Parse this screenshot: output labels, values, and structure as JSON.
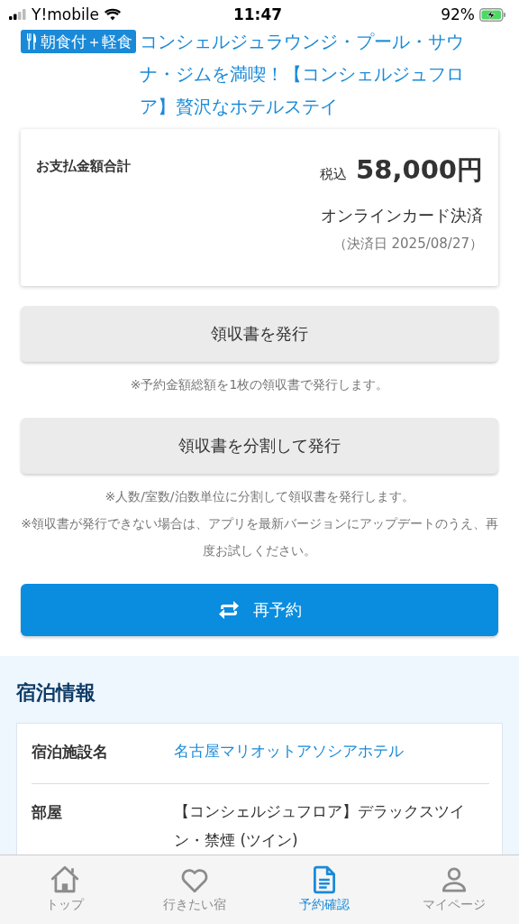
{
  "status_bar": {
    "carrier": "Y!mobile",
    "time": "11:47",
    "battery": "92%"
  },
  "plan": {
    "badge": "朝食付＋軽食",
    "title": "コンシェルジュラウンジ・プール・サウナ・ジムを満喫！【コンシェルジュフロア】贅沢なホテルステイ"
  },
  "payment": {
    "label": "お支払金額合計",
    "tax_label": "税込",
    "amount": "58,000円",
    "method": "オンラインカード決済",
    "date": "（決済日 2025/08/27）"
  },
  "actions": [
    {
      "kind": "plain",
      "label": "領収書を発行",
      "notes": [
        "※予約金額総額を1枚の領収書で発行します。"
      ]
    },
    {
      "kind": "plain",
      "label": "領収書を分割して発行",
      "notes": [
        "※人数/室数/泊数単位に分割して領収書を発行します。",
        "※領収書が発行できない場合は、アプリを最新バージョンにアップデートのうえ、再度お試しください。"
      ]
    },
    {
      "kind": "primary",
      "label": "再予約"
    }
  ],
  "stay_info": {
    "heading": "宿泊情報",
    "rows": [
      {
        "label": "宿泊施設名",
        "value": "名古屋マリオットアソシアホテル",
        "kind": "link"
      },
      {
        "label": "部屋",
        "value": "【コンシェルジュフロア】デラックスツイン・禁煙 (ツイン)",
        "kind": "text"
      }
    ]
  },
  "tab_bar": [
    {
      "label": "トップ",
      "selected": false
    },
    {
      "label": "行きたい宿",
      "selected": false
    },
    {
      "label": "予約確認",
      "selected": true
    },
    {
      "label": "マイページ",
      "selected": false
    }
  ]
}
